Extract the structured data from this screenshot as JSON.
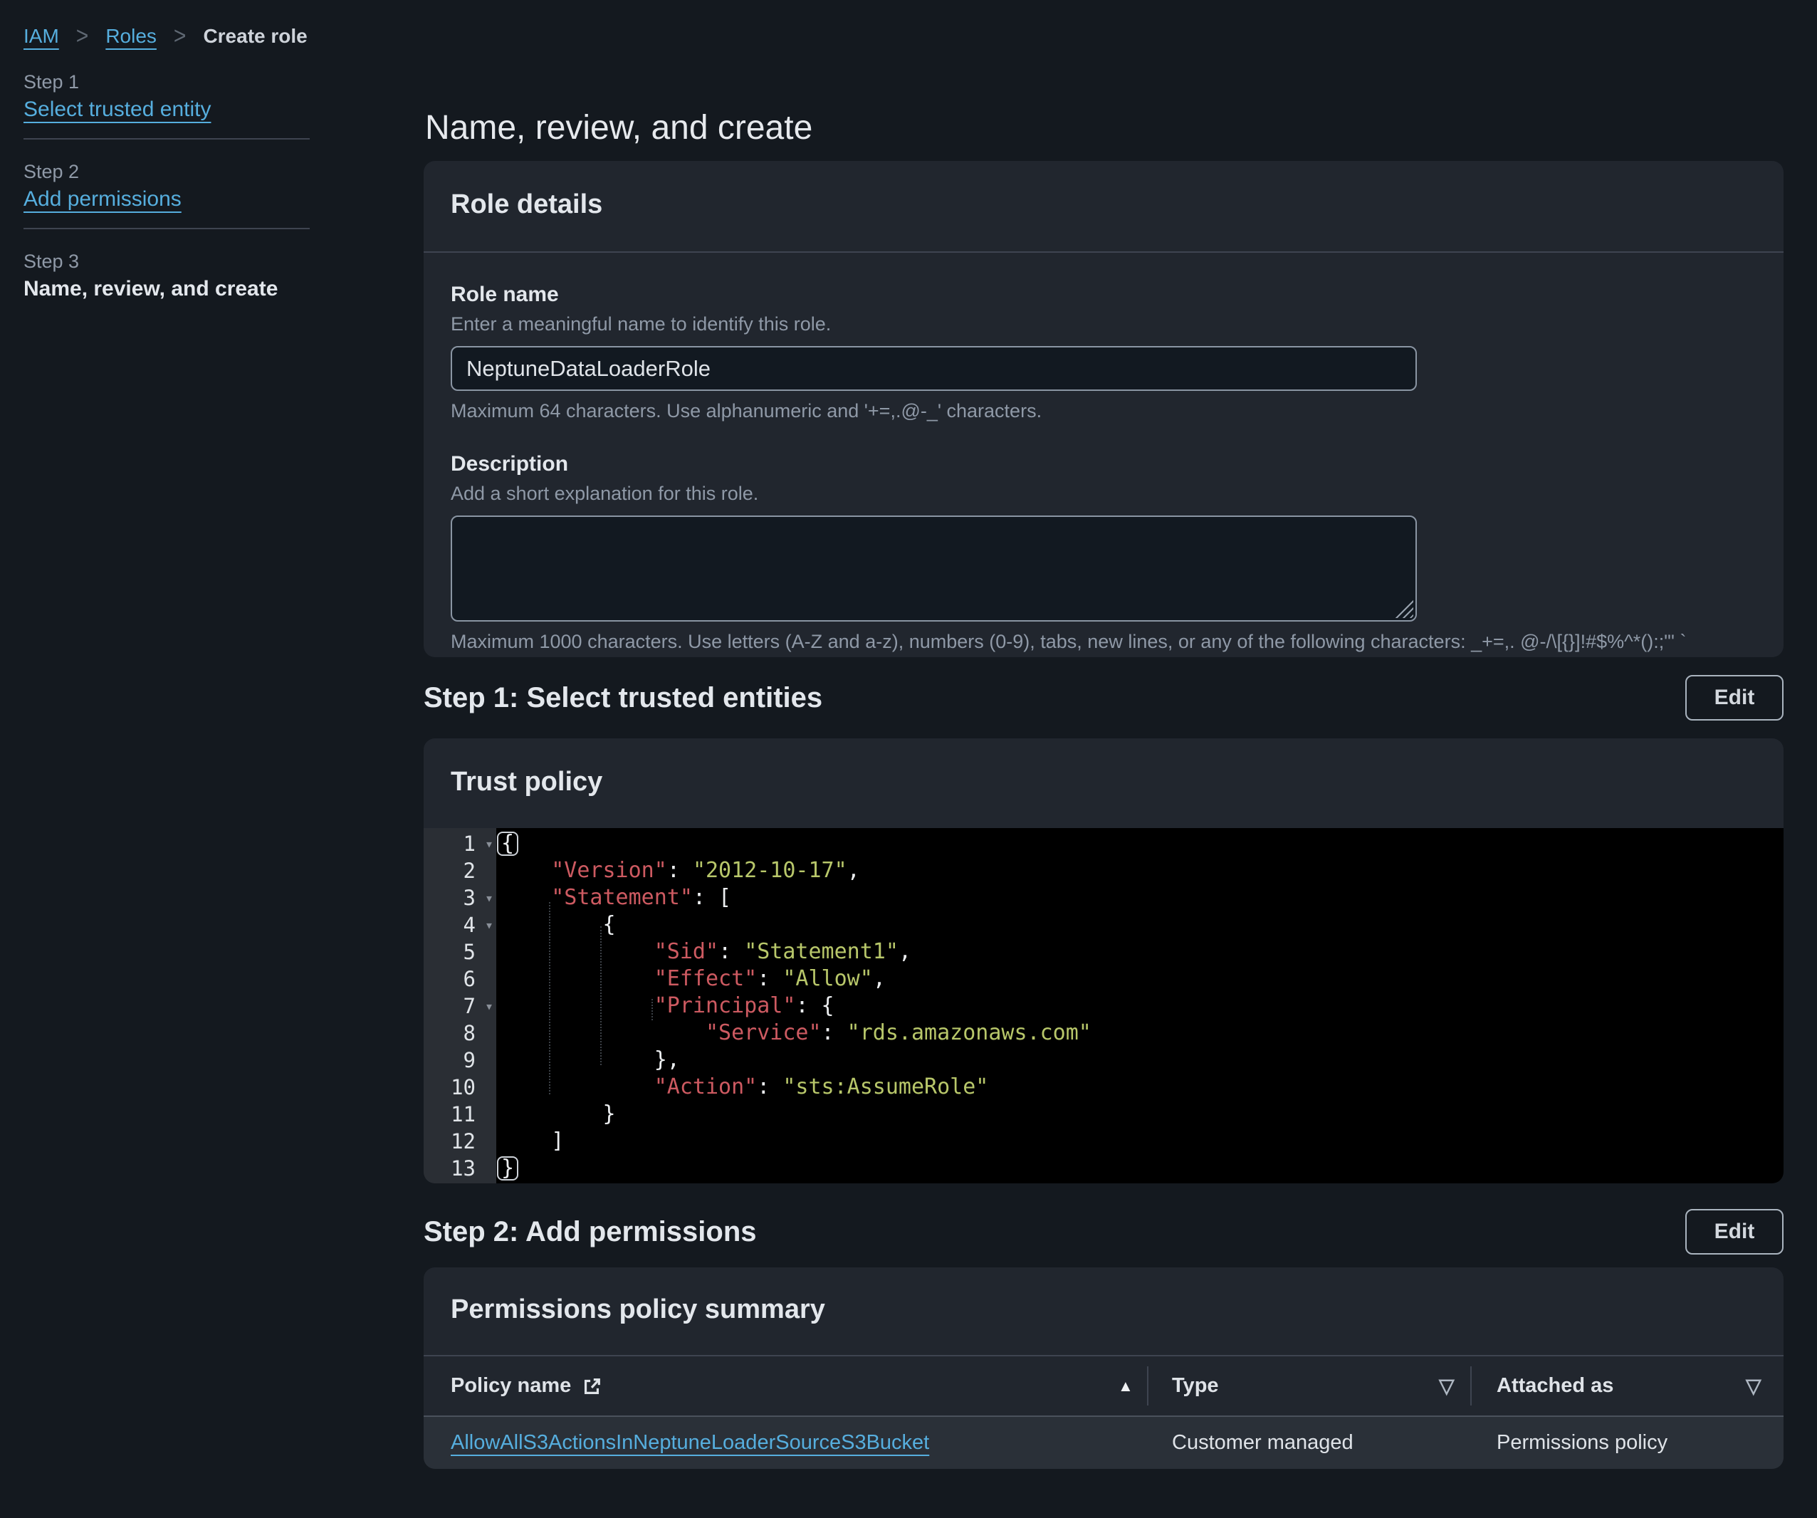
{
  "breadcrumb": {
    "items": [
      "IAM",
      "Roles",
      "Create role"
    ]
  },
  "sidebar": {
    "steps": [
      {
        "step": "Step 1",
        "title": "Select trusted entity"
      },
      {
        "step": "Step 2",
        "title": "Add permissions"
      },
      {
        "step": "Step 3",
        "title": "Name, review, and create"
      }
    ]
  },
  "main": {
    "title": "Name, review, and create"
  },
  "role_details": {
    "title": "Role details",
    "role_name_label": "Role name",
    "role_name_desc": "Enter a meaningful name to identify this role.",
    "role_name_value": "NeptuneDataLoaderRole",
    "role_name_hint": "Maximum 64 characters. Use alphanumeric and '+=,.@-_' characters.",
    "description_label": "Description",
    "description_desc": "Add a short explanation for this role.",
    "description_value": "",
    "description_hint": "Maximum 1000 characters. Use letters (A-Z and a-z), numbers (0-9), tabs, new lines, or any of the following characters: _+=,. @-/\\[{}]!#$%^*():;\"' `"
  },
  "step1_section": {
    "heading": "Step 1: Select trusted entities",
    "edit_label": "Edit",
    "panel_title": "Trust policy",
    "code_lines": [
      "{",
      "    \"Version\": \"2012-10-17\",",
      "    \"Statement\": [",
      "        {",
      "            \"Sid\": \"Statement1\",",
      "            \"Effect\": \"Allow\",",
      "            \"Principal\": {",
      "                \"Service\": \"rds.amazonaws.com\"",
      "            },",
      "            \"Action\": \"sts:AssumeRole\"",
      "        }",
      "    ]",
      "}"
    ],
    "fold_lines": [
      1,
      3,
      4,
      7
    ],
    "bracket_highlight_lines": [
      1,
      13
    ]
  },
  "step2_section": {
    "heading": "Step 2: Add permissions",
    "edit_label": "Edit",
    "panel_title": "Permissions policy summary",
    "table": {
      "columns": [
        "Policy name",
        "Type",
        "Attached as"
      ],
      "rows": [
        {
          "policy_name": "AllowAllS3ActionsInNeptuneLoaderSourceS3Bucket",
          "type": "Customer managed",
          "attached_as": "Permissions policy"
        }
      ]
    }
  },
  "colors": {
    "page_bg": "#14191f",
    "container_bg": "#21262e",
    "link": "#56aede",
    "code_key": "#cd5a61",
    "code_value": "#b8c76a",
    "code_punct": "#eceef0"
  }
}
